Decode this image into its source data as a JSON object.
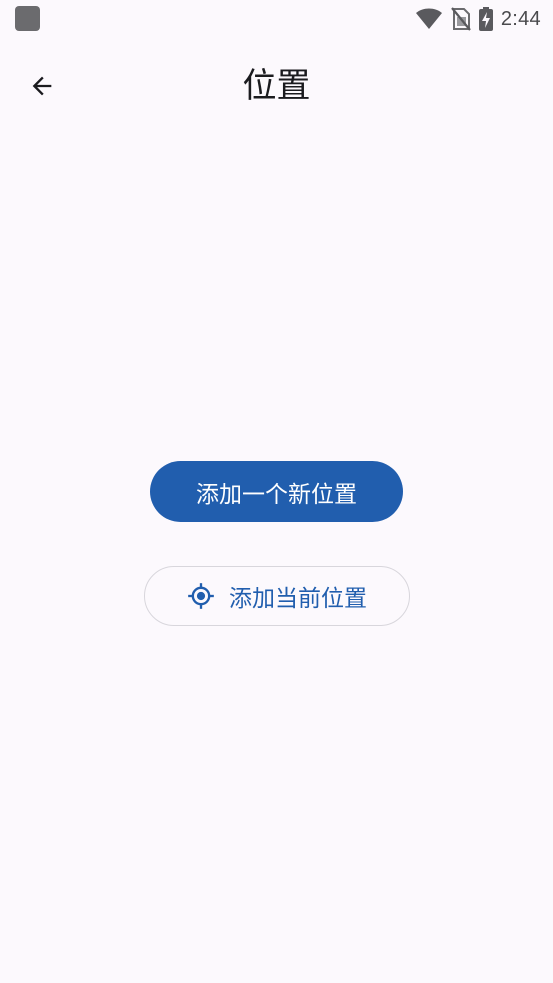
{
  "status_bar": {
    "time": "2:44",
    "icons": [
      "app-notification-icon",
      "wifi-icon",
      "no-sim-icon",
      "battery-charging-icon"
    ]
  },
  "top_bar": {
    "back_icon": "arrow-back-icon",
    "title": "位置"
  },
  "main": {
    "add_new_location_label": "添加一个新位置",
    "add_current_location_label": "添加当前位置",
    "add_current_location_icon": "my-location-icon"
  },
  "colors": {
    "background": "#fcf9fd",
    "primary": "#215eae",
    "on_primary": "#ffffff",
    "outline": "#d8d6dc",
    "text": "#1b1b1f"
  }
}
